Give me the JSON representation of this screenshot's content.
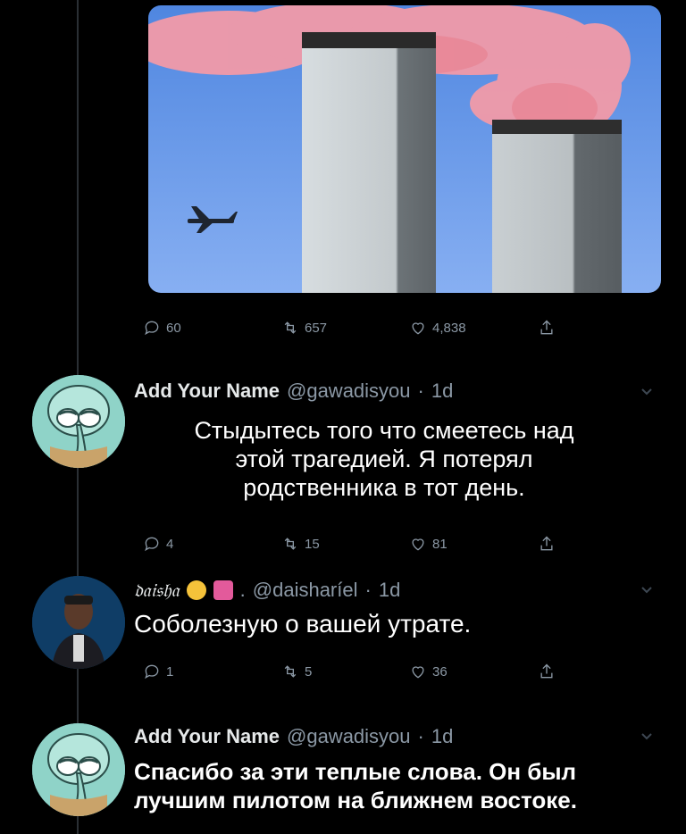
{
  "main_tweet": {
    "stats": {
      "replies": "60",
      "retweets": "657",
      "likes": "4,838"
    }
  },
  "replies": [
    {
      "name": "Add Your Name",
      "handle": "@gawadisyou",
      "time": "1d",
      "text_lines": [
        "Стыдытесь того что смеетесь над",
        "этой трагедией. Я потерял",
        "родственника в тот день."
      ],
      "stats": {
        "replies": "4",
        "retweets": "15",
        "likes": "81"
      }
    },
    {
      "name": "𝔡𝔞𝔦𝔰𝔥𝔞",
      "handle": "@daisharíel",
      "time": "1d",
      "separator": ".",
      "text_lines": [
        "Соболезную о вашей утрате."
      ],
      "stats": {
        "replies": "1",
        "retweets": "5",
        "likes": "36"
      }
    },
    {
      "name": "Add Your Name",
      "handle": "@gawadisyou",
      "time": "1d",
      "text_lines": [
        "Спасибо за эти теплые слова. Он был",
        "лучшим пилотом на ближнем востоке."
      ]
    }
  ],
  "colors": {
    "background": "#000000",
    "muted": "#8b98a5",
    "text": "#ffffff"
  }
}
